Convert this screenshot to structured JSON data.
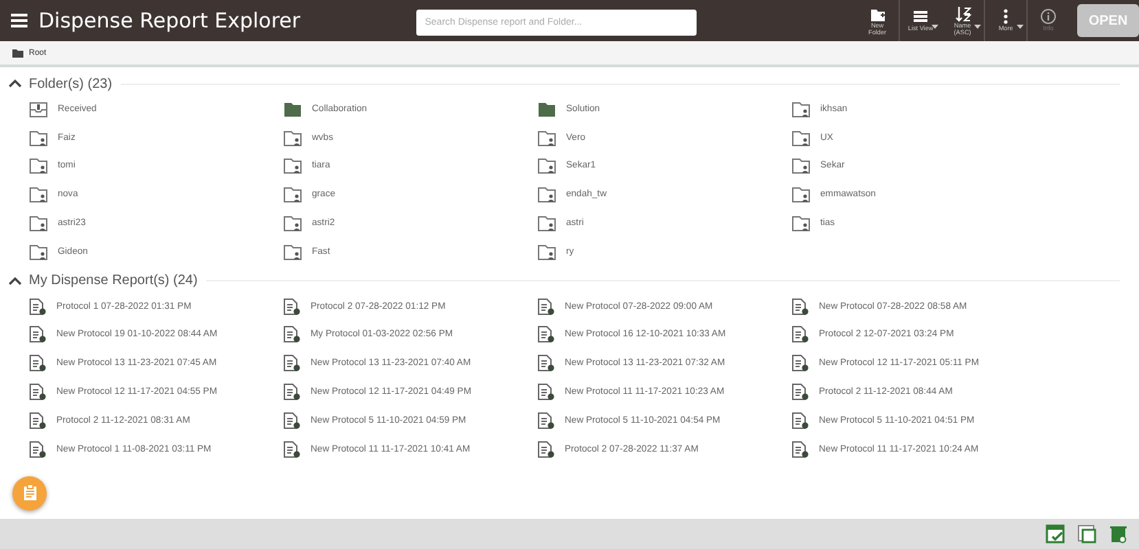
{
  "header": {
    "title": "Dispense Report Explorer",
    "search": {
      "placeholder": "Search Dispense report and Folder..."
    },
    "tools": [
      {
        "kind": "new-folder",
        "label": "New Folder",
        "caret": false,
        "disabled": false
      },
      {
        "kind": "list",
        "label": "List View",
        "caret": true,
        "disabled": false
      },
      {
        "kind": "sort",
        "label": "Name (ASC)",
        "caret": true,
        "disabled": false
      },
      {
        "kind": "more",
        "label": "More",
        "caret": true,
        "disabled": false
      },
      {
        "kind": "info",
        "label": "Info",
        "caret": false,
        "disabled": true
      }
    ],
    "open_button": {
      "label": "OPEN",
      "disabled": true
    }
  },
  "breadcrumb": {
    "label": "Root"
  },
  "sections": [
    {
      "title": "Folder(s) (23)",
      "expanded": true,
      "kind": "folders",
      "items": [
        {
          "label": "Received",
          "kind": "received"
        },
        {
          "label": "Collaboration",
          "kind": "shared"
        },
        {
          "label": "Solution",
          "kind": "shared"
        },
        {
          "label": "ikhsan",
          "kind": "user"
        },
        {
          "label": "Faiz",
          "kind": "user"
        },
        {
          "label": "wvbs",
          "kind": "user"
        },
        {
          "label": "Vero",
          "kind": "user"
        },
        {
          "label": "UX",
          "kind": "user"
        },
        {
          "label": "tomi",
          "kind": "user"
        },
        {
          "label": "tiara",
          "kind": "user"
        },
        {
          "label": "Sekar1",
          "kind": "user"
        },
        {
          "label": "Sekar",
          "kind": "user"
        },
        {
          "label": "nova",
          "kind": "user"
        },
        {
          "label": "grace",
          "kind": "user"
        },
        {
          "label": "endah_tw",
          "kind": "user"
        },
        {
          "label": "emmawatson",
          "kind": "user"
        },
        {
          "label": "astri23",
          "kind": "user"
        },
        {
          "label": "astri2",
          "kind": "user"
        },
        {
          "label": "astri",
          "kind": "user"
        },
        {
          "label": "tias",
          "kind": "user"
        },
        {
          "label": "Gideon",
          "kind": "user"
        },
        {
          "label": "Fast",
          "kind": "user"
        },
        {
          "label": "ry",
          "kind": "user"
        }
      ]
    },
    {
      "title": "My Dispense Report(s) (24)",
      "expanded": true,
      "kind": "reports",
      "items": [
        {
          "label": "Protocol 1 07-28-2022 01:31 PM"
        },
        {
          "label": "Protocol 2 07-28-2022 01:12 PM"
        },
        {
          "label": "New Protocol 07-28-2022 09:00 AM"
        },
        {
          "label": "New Protocol 07-28-2022 08:58 AM"
        },
        {
          "label": "New Protocol 19 01-10-2022 08:44 AM"
        },
        {
          "label": "My Protocol 01-03-2022 02:56 PM"
        },
        {
          "label": "New Protocol 16 12-10-2021 10:33 AM"
        },
        {
          "label": "Protocol 2 12-07-2021 03:24 PM"
        },
        {
          "label": "New Protocol 13 11-23-2021 07:45 AM"
        },
        {
          "label": "New Protocol 13 11-23-2021 07:40 AM"
        },
        {
          "label": "New Protocol 13 11-23-2021 07:32 AM"
        },
        {
          "label": "New Protocol 12 11-17-2021 05:11 PM"
        },
        {
          "label": "New Protocol 12 11-17-2021 04:55 PM"
        },
        {
          "label": "New Protocol 12 11-17-2021 04:49 PM"
        },
        {
          "label": "New Protocol 11 11-17-2021 10:23 AM"
        },
        {
          "label": "Protocol 2 11-12-2021 08:44 AM"
        },
        {
          "label": "Protocol 2 11-12-2021 08:31 AM"
        },
        {
          "label": "New Protocol 5 11-10-2021 04:59 PM"
        },
        {
          "label": "New Protocol 5 11-10-2021 04:54 PM"
        },
        {
          "label": "New Protocol 5 11-10-2021 04:51 PM"
        },
        {
          "label": "New Protocol 1 11-08-2021 03:11 PM"
        },
        {
          "label": "New Protocol 11 11-17-2021 10:41 AM"
        },
        {
          "label": "Protocol 2 07-28-2022 11:37 AM"
        },
        {
          "label": "New Protocol 11 11-17-2021 10:24 AM"
        }
      ]
    }
  ],
  "footer_tools": [
    {
      "kind": "check"
    },
    {
      "kind": "window"
    },
    {
      "kind": "trash"
    }
  ]
}
